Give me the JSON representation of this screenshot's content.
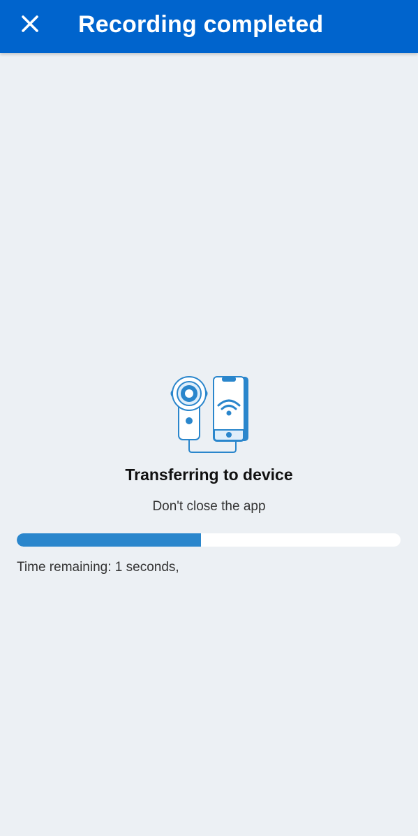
{
  "header": {
    "title": "Recording completed",
    "close_icon": "close-icon",
    "background_color": "#0064cd"
  },
  "transfer": {
    "illustration_icon": "stethoscope-to-phone-transfer-icon",
    "heading": "Transferring to device",
    "subtext": "Don't close the app",
    "progress": 0.48,
    "progress_color": "#2a86cc",
    "time_remaining": "Time remaining: 1 seconds,"
  }
}
